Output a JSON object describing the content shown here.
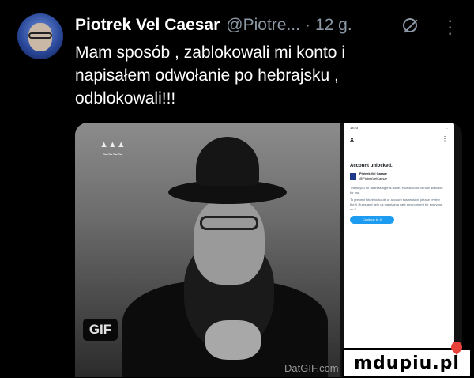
{
  "header": {
    "name": "Piotrek Vel Caesar",
    "handle": "@Piotre...",
    "separator": "·",
    "time": "12 g."
  },
  "tweet": {
    "text": "Mam sposób , zablokowali mi konto i napisałem odwołanie po hebrajsku , odblokowali!!!"
  },
  "media": {
    "gif_badge": "GIF",
    "gif_watermark": "DatGIF.com"
  },
  "phone": {
    "status_time": "18:23",
    "status_icons": "...",
    "close": "x",
    "more": "⋮",
    "title": "Account unlocked.",
    "account_name": "Piotrek Vel Caesar",
    "account_handle": "@PiotrekVelCaesar",
    "para1": "Thank you for addressing this issue. Your account is now available for use.",
    "para2": "To prevent future lockouts or account suspension, please review the X Rules and help us maintain a safe environment for everyone on X.",
    "cta": "Continue to X"
  },
  "site_watermark": "mdupiu.pl",
  "icons": [
    "slash-icon",
    "more-icon"
  ]
}
